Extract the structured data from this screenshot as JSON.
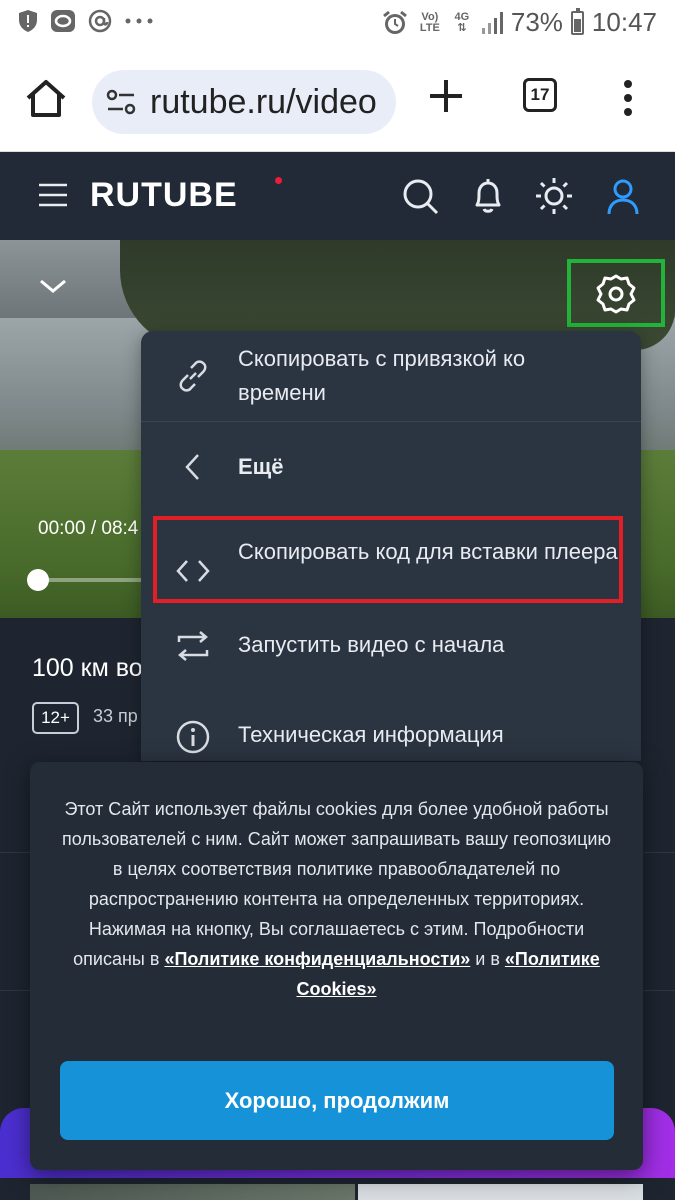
{
  "status_bar": {
    "network": "4G",
    "volte": "Vo) LTE",
    "battery_percent": "73%",
    "time": "10:47",
    "battery_level": 0.73,
    "icons": [
      "shield-icon",
      "ring-icon",
      "at-icon",
      "more-dots-icon",
      "alarm-icon",
      "signal-icon",
      "battery-icon"
    ]
  },
  "browser": {
    "url": "rutube.ru/video",
    "tab_count": "17"
  },
  "header": {
    "logo": "RUTUBE",
    "accent_color": "#ed1c3a",
    "user_icon_color": "#2f9bff"
  },
  "video": {
    "time_current": "00:00",
    "time_separator": "/",
    "time_total": "08:4",
    "progress": 0.0
  },
  "settings_menu": {
    "items": [
      {
        "icon": "link-icon",
        "label": "Скопировать с привязкой ко времени"
      },
      {
        "icon": "chevron-left-icon",
        "label": "Ещё"
      },
      {
        "icon": "code-icon",
        "label": "Скопировать код для вставки плеера"
      },
      {
        "icon": "repeat-icon",
        "label": "Запустить видео с начала"
      },
      {
        "icon": "info-icon",
        "label": "Техническая информация"
      }
    ]
  },
  "video_info": {
    "title": "100 км во",
    "age_rating": "12+",
    "views": "33 пр"
  },
  "cookie_dialog": {
    "text_main": "Этот Сайт использует файлы cookies для более удобной работы пользователей с ним. Сайт может запрашивать вашу геопозицию в целях соответствия политике правообладателей по распространению контента на определенных территориях. Нажимая на кнопку, Вы соглашаетесь с этим. Подробности описаны в ",
    "link_privacy": "«Политике конфиденциальности»",
    "text_and": " и в ",
    "link_cookies": "«Политике Cookies»",
    "button_label": "Хорошо, продолжим",
    "button_color": "#1592d8"
  },
  "highlights": {
    "gear_box_color": "#22b43a",
    "embed_box_color": "#e21f26"
  }
}
